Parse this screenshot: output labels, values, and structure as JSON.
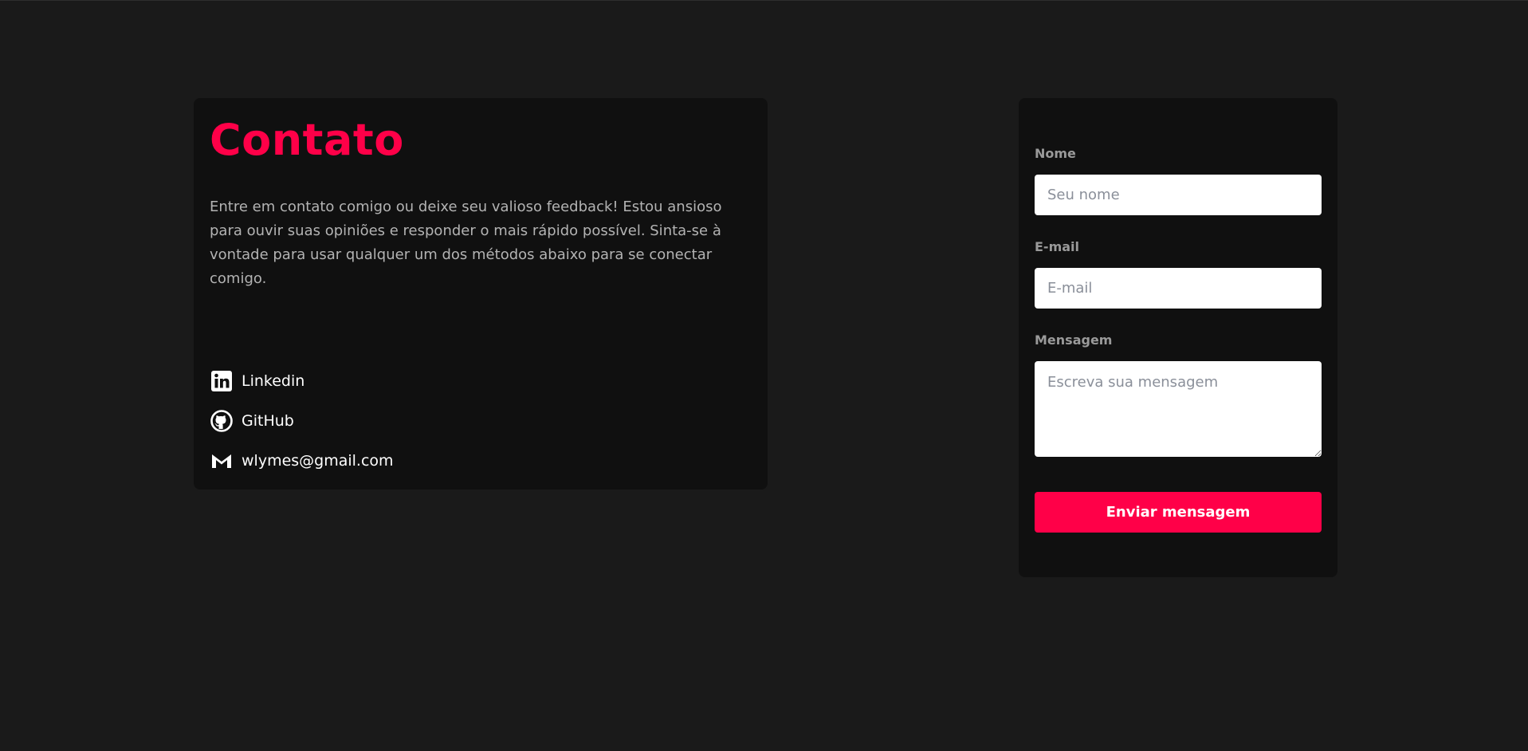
{
  "contact": {
    "title": "Contato",
    "description": "Entre em contato comigo ou deixe seu valioso feedback! Estou ansioso para ouvir suas opiniões e responder o mais rápido possível. Sinta-se à vontade para usar qualquer um dos métodos abaixo para se conectar comigo.",
    "links": [
      {
        "label": "Linkedin",
        "icon": "linkedin-icon"
      },
      {
        "label": "GitHub",
        "icon": "github-icon"
      },
      {
        "label": "wlymes@gmail.com",
        "icon": "gmail-icon"
      }
    ]
  },
  "form": {
    "name_label": "Nome",
    "name_placeholder": "Seu nome",
    "email_label": "E-mail",
    "email_placeholder": "E-mail",
    "message_label": "Mensagem",
    "message_placeholder": "Escreva sua mensagem",
    "submit_label": "Enviar mensagem"
  },
  "colors": {
    "accent": "#ff0048",
    "background": "#1a1a1a",
    "card": "#101010"
  }
}
